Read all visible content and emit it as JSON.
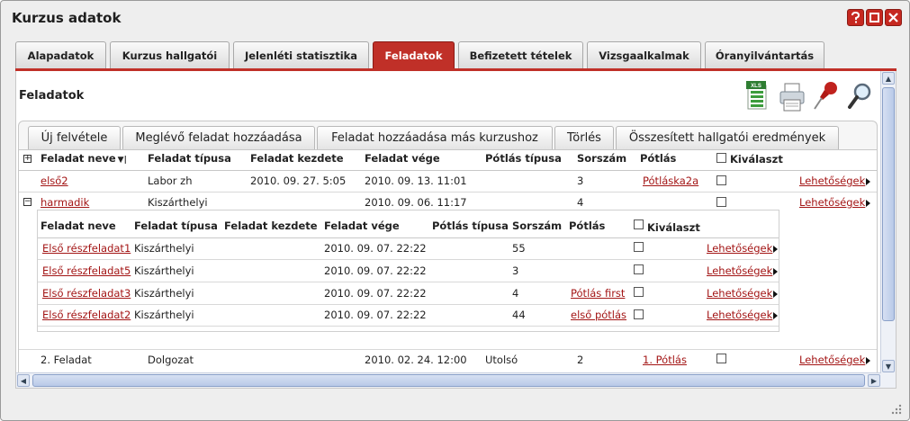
{
  "window": {
    "title": "Kurzus adatok"
  },
  "tabs": [
    {
      "label": "Alapadatok",
      "active": false
    },
    {
      "label": "Kurzus hallgatói",
      "active": false
    },
    {
      "label": "Jelenléti statisztika",
      "active": false
    },
    {
      "label": "Feladatok",
      "active": true
    },
    {
      "label": "Befizetett tételek",
      "active": false
    },
    {
      "label": "Vizsgaalkalmak",
      "active": false
    },
    {
      "label": "Óranyilvántartás",
      "active": false
    }
  ],
  "panel": {
    "title": "Feladatok",
    "icons": [
      "excel-export-icon",
      "print-icon",
      "pin-icon",
      "search-icon"
    ],
    "excel_label": "XLS"
  },
  "toolbar": {
    "new": "Új felvétele",
    "add_existing": "Meglévő feladat hozzáadása",
    "add_other": "Feladat hozzáadása más kurzushoz",
    "delete": "Törlés",
    "summary": "Összesített hallgatói eredmények"
  },
  "grid": {
    "columns": {
      "name": "Feladat neve",
      "type": "Feladat típusa",
      "start": "Feladat kezdete",
      "end": "Feladat vége",
      "retake_type": "Pótlás típusa",
      "order": "Sorszám",
      "retake": "Pótlás",
      "select": "Kiválaszt"
    },
    "rows": [
      {
        "name": "első2",
        "type": "Labor zh",
        "start": "2010. 09. 27. 5:05",
        "end": "2010. 09. 13. 11:01",
        "retake_type": "",
        "order": "3",
        "retake": "Pótláska2a",
        "options": "Lehetőségek"
      },
      {
        "name": "harmadik",
        "type": "Kiszárthelyi",
        "start": "",
        "end": "2010. 09. 06. 11:17",
        "retake_type": "",
        "order": "4",
        "retake": "",
        "options": "Lehetőségek"
      },
      {
        "name": "2. Feladat",
        "type": "Dolgozat",
        "start": "",
        "end": "2010. 02. 24. 12:00",
        "retake_type": "Utolsó",
        "order": "2",
        "retake": "1. Pótlás",
        "options": "Lehetőségek"
      }
    ],
    "subgrid": {
      "columns": {
        "name": "Feladat neve",
        "type": "Feladat típusa",
        "start": "Feladat kezdete",
        "end": "Feladat vége",
        "retake_type": "Pótlás típusa",
        "order": "Sorszám",
        "retake": "Pótlás",
        "select": "Kiválaszt"
      },
      "rows": [
        {
          "name": "Első részfeladat1",
          "type": "Kiszárthelyi",
          "end": "2010. 09. 07. 22:22",
          "order": "55",
          "retake": "",
          "options": "Lehetőségek"
        },
        {
          "name": "Első részfeladat5",
          "type": "Kiszárthelyi",
          "end": "2010. 09. 07. 22:22",
          "order": "3",
          "retake": "",
          "options": "Lehetőségek"
        },
        {
          "name": "Első részfeladat3",
          "type": "Kiszárthelyi",
          "end": "2010. 09. 07. 22:22",
          "order": "4",
          "retake": "Pótlás first",
          "options": "Lehetőségek"
        },
        {
          "name": "Első részfeladat2",
          "type": "Kiszárthelyi",
          "end": "2010. 09. 07. 22:22",
          "order": "44",
          "retake": "első pótlás",
          "options": "Lehetőségek"
        }
      ]
    }
  },
  "colors": {
    "accent": "#c03028",
    "link": "#a31515"
  }
}
